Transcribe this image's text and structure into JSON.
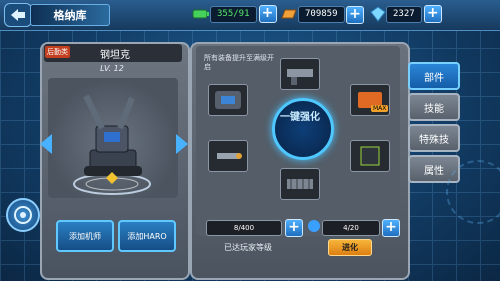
{
  "title": "格纳库",
  "resources": [
    {
      "name": "energy",
      "value": "355/91",
      "icon": "battery-icon",
      "color": "#44d15c"
    },
    {
      "name": "gold",
      "value": "709859",
      "icon": "gold-bar-icon",
      "color": "#f0a13a"
    },
    {
      "name": "gems",
      "value": "2327",
      "icon": "gem-icon",
      "color": "#7fd8ff"
    }
  ],
  "unit": {
    "tag": "后勤类",
    "name": "钢坦克",
    "level": "LV. 12"
  },
  "left_buttons": {
    "add_mecha": "添加机师",
    "add_haro": "添加HARO"
  },
  "parts_note": "所有装备提升至满级开启",
  "center_label": "一键强化",
  "max_label": "MAX",
  "progress": [
    {
      "value": "8/400"
    },
    {
      "value": "4/20"
    }
  ],
  "reach_text": "已达玩家等级",
  "evolve_label": "进化",
  "tabs": [
    "部件",
    "技能",
    "特殊技",
    "属性"
  ]
}
